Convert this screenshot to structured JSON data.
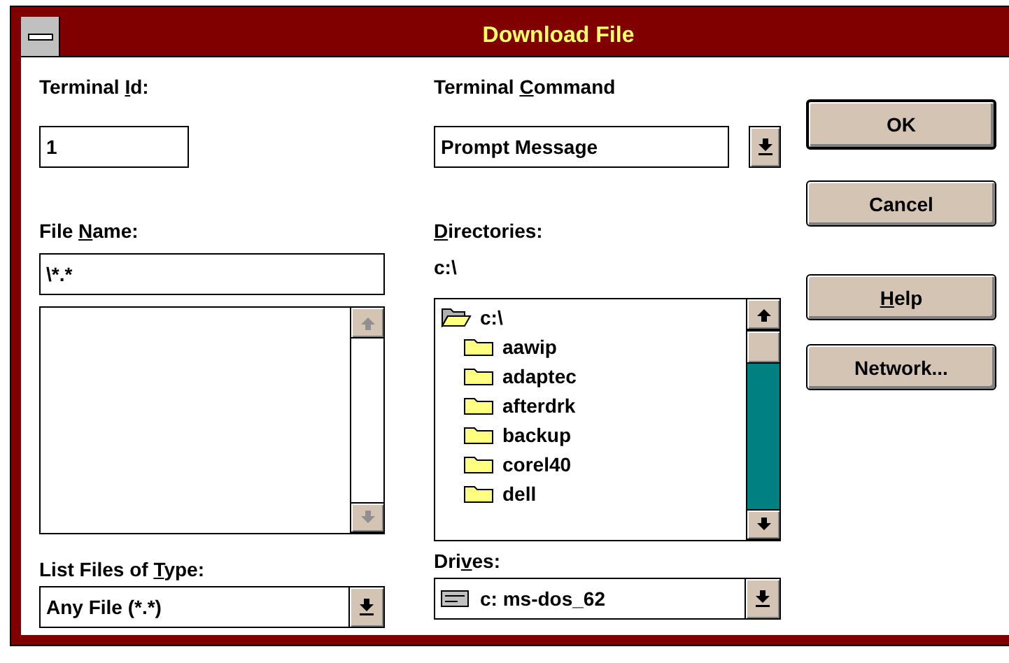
{
  "window": {
    "title": "Download File"
  },
  "terminal_id": {
    "label": [
      {
        "text": "Terminal ",
        "underlined": false
      },
      {
        "text": "I",
        "underlined": true
      },
      {
        "text": "d:",
        "underlined": false
      }
    ],
    "value": "1"
  },
  "terminal_command": {
    "label": [
      {
        "text": "Terminal ",
        "underlined": false
      },
      {
        "text": "C",
        "underlined": true
      },
      {
        "text": "ommand",
        "underlined": false
      }
    ],
    "value": "Prompt Message"
  },
  "file_name": {
    "label": [
      {
        "text": "File ",
        "underlined": false
      },
      {
        "text": "N",
        "underlined": true
      },
      {
        "text": "ame:",
        "underlined": false
      }
    ],
    "value": "\\*.*"
  },
  "list_files_of_type": {
    "label": [
      {
        "text": "List Files of ",
        "underlined": false
      },
      {
        "text": "T",
        "underlined": true
      },
      {
        "text": "ype:",
        "underlined": false
      }
    ],
    "value": "Any File (*.*)"
  },
  "directories": {
    "label": [
      {
        "text": "D",
        "underlined": true
      },
      {
        "text": "irectories:",
        "underlined": false
      }
    ],
    "path": "c:\\",
    "tree": [
      {
        "name": "c:\\",
        "expanded": true,
        "children": [
          {
            "name": "aawip",
            "expanded": false
          },
          {
            "name": "adaptec",
            "expanded": false
          },
          {
            "name": "afterdrk",
            "expanded": false
          },
          {
            "name": "backup",
            "expanded": false
          },
          {
            "name": "corel40",
            "expanded": false
          },
          {
            "name": "dell",
            "expanded": false
          }
        ]
      }
    ]
  },
  "drives": {
    "label": [
      {
        "text": "Dri",
        "underlined": false
      },
      {
        "text": "v",
        "underlined": true
      },
      {
        "text": "es:",
        "underlined": false
      }
    ],
    "value": "c: ms-dos_62"
  },
  "buttons": [
    {
      "label": [
        {
          "text": "OK",
          "underlined": false
        }
      ],
      "default": true
    },
    {
      "label": [
        {
          "text": "Cancel",
          "underlined": false
        }
      ],
      "default": false
    },
    {
      "label": [
        {
          "text": "H",
          "underlined": true
        },
        {
          "text": "elp",
          "underlined": false
        }
      ],
      "default": false
    },
    {
      "label": [
        {
          "text": "Network...",
          "underlined": false
        }
      ],
      "default": false
    }
  ]
}
